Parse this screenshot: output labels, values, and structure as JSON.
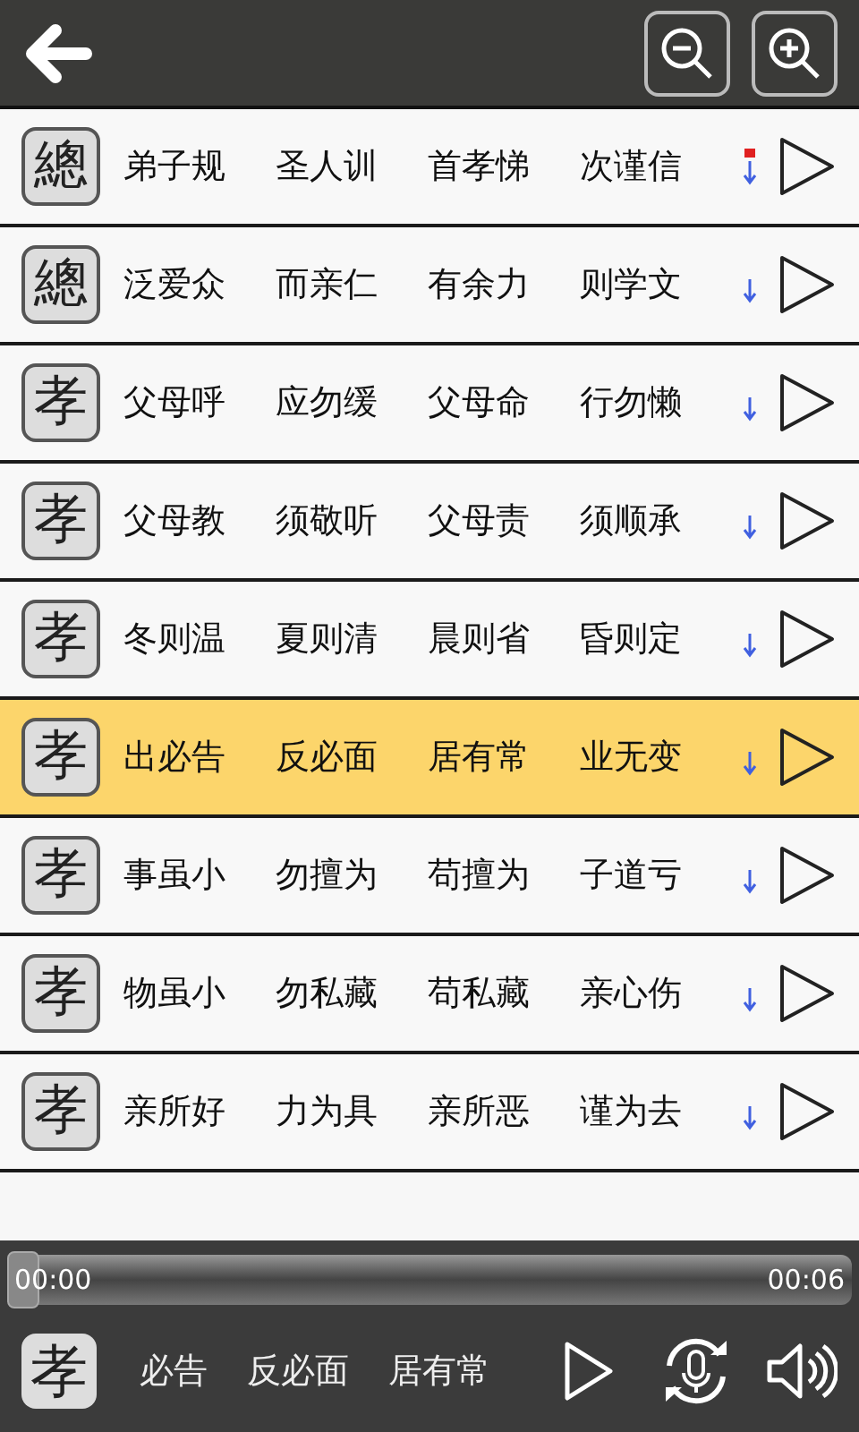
{
  "rows": [
    {
      "seal": "總",
      "phrases": [
        "弟子规",
        "圣人训",
        "首孝悌",
        "次谨信"
      ],
      "marked": true,
      "selected": false
    },
    {
      "seal": "總",
      "phrases": [
        "泛爱众",
        "而亲仁",
        "有余力",
        "则学文"
      ],
      "marked": false,
      "selected": false
    },
    {
      "seal": "孝",
      "phrases": [
        "父母呼",
        "应勿缓",
        "父母命",
        "行勿懒"
      ],
      "marked": false,
      "selected": false
    },
    {
      "seal": "孝",
      "phrases": [
        "父母教",
        "须敬听",
        "父母责",
        "须顺承"
      ],
      "marked": false,
      "selected": false
    },
    {
      "seal": "孝",
      "phrases": [
        "冬则温",
        "夏则清",
        "晨则省",
        "昏则定"
      ],
      "marked": false,
      "selected": false
    },
    {
      "seal": "孝",
      "phrases": [
        "出必告",
        "反必面",
        "居有常",
        "业无变"
      ],
      "marked": false,
      "selected": true
    },
    {
      "seal": "孝",
      "phrases": [
        "事虽小",
        "勿擅为",
        "苟擅为",
        "子道亏"
      ],
      "marked": false,
      "selected": false
    },
    {
      "seal": "孝",
      "phrases": [
        "物虽小",
        "勿私藏",
        "苟私藏",
        "亲心伤"
      ],
      "marked": false,
      "selected": false
    },
    {
      "seal": "孝",
      "phrases": [
        "亲所好",
        "力为具",
        "亲所恶",
        "谨为去"
      ],
      "marked": false,
      "selected": false
    }
  ],
  "player": {
    "elapsed": "00:00",
    "duration": "00:06",
    "level": 0,
    "seal": "孝",
    "now_playing": [
      "必告",
      "反必面",
      "居有常"
    ]
  }
}
